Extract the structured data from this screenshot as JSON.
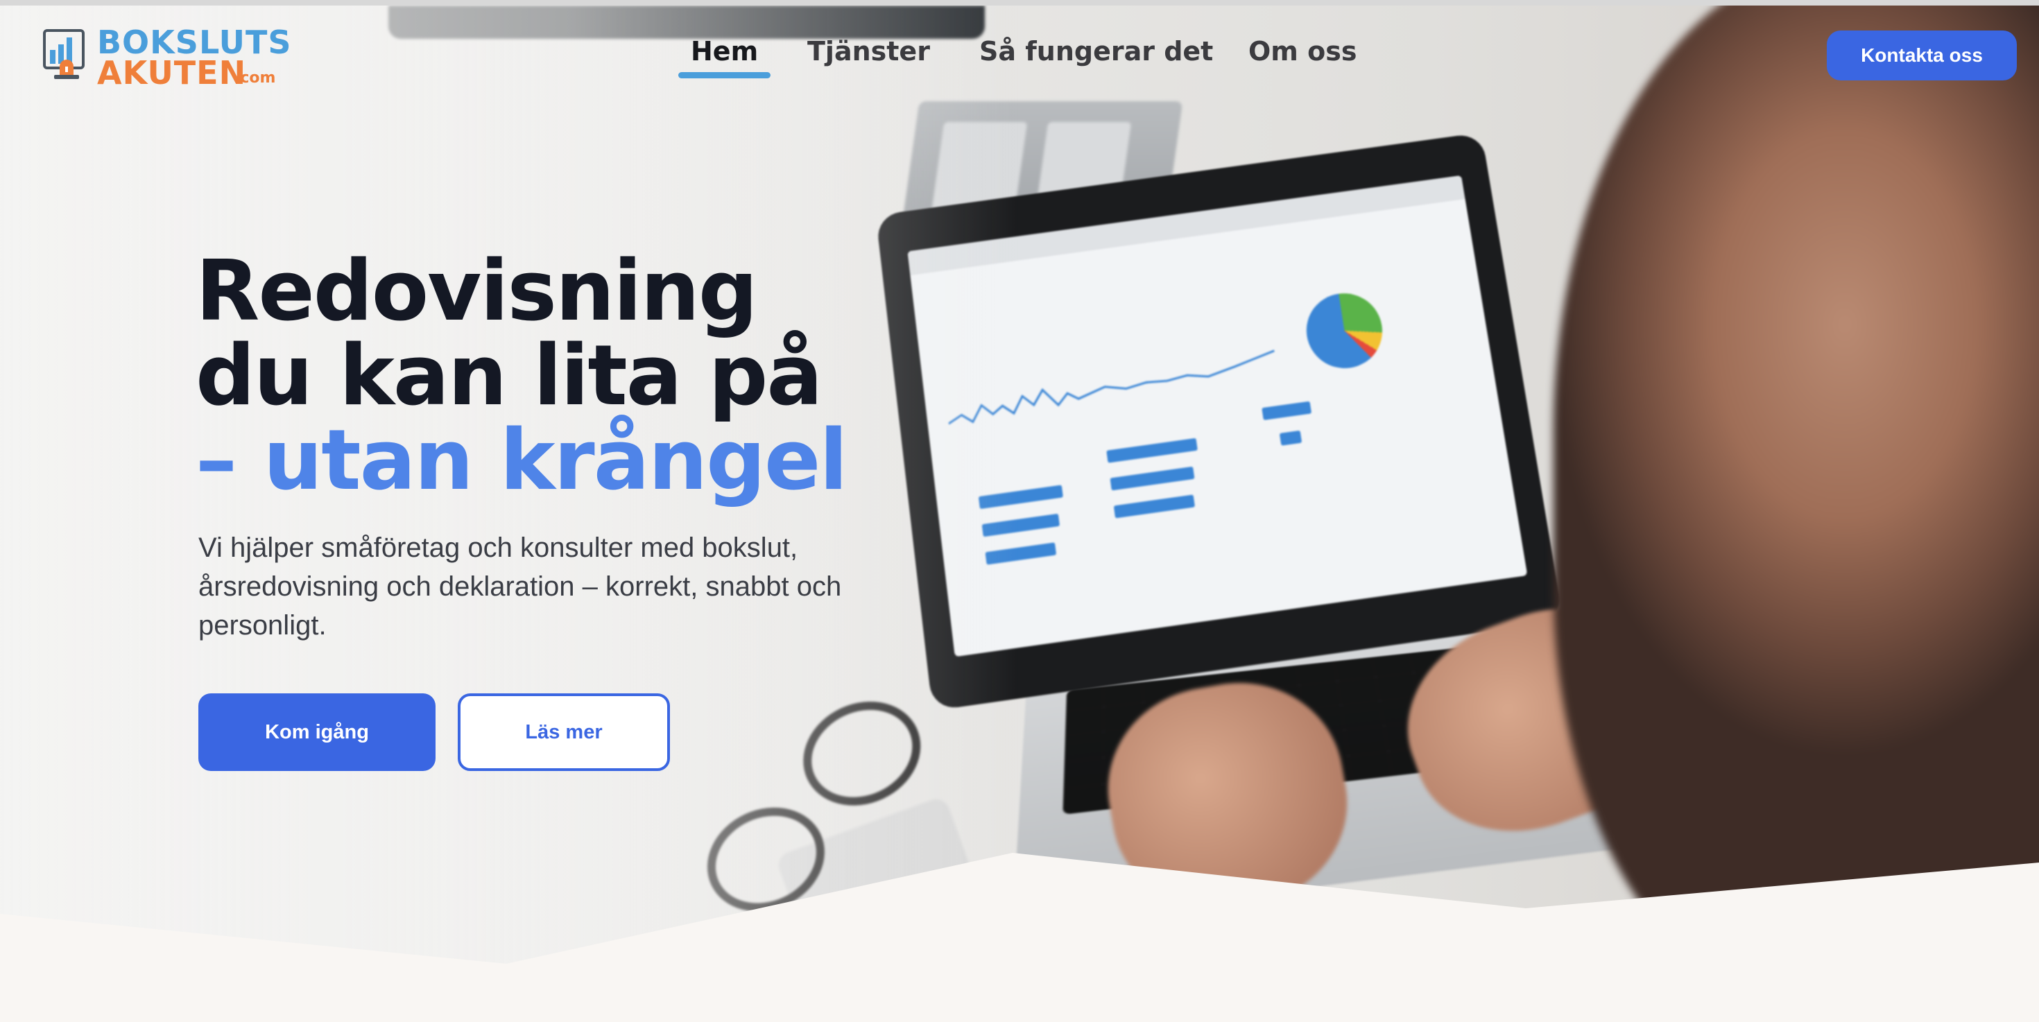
{
  "brand": {
    "line1": "BOKSLUTS",
    "line2": "AKUTEN",
    "suffix": ".com"
  },
  "nav": {
    "items": [
      {
        "label": "Hem",
        "active": true
      },
      {
        "label": "Tjänster",
        "active": false
      },
      {
        "label": "Så fungerar det",
        "active": false
      },
      {
        "label": "Om oss",
        "active": false
      }
    ]
  },
  "header": {
    "cta_label": "Kontakta oss"
  },
  "hero": {
    "headline_line1": "Redovisning",
    "headline_line2": "du kan lita på",
    "headline_line3": "– utan krångel",
    "subtext": "Vi hjälper småföretag och konsulter med bokslut, årsredovisning och deklaration – korrekt, snabbt och personligt.",
    "primary_button": "Kom igång",
    "secondary_button": "Läs mer"
  },
  "colors": {
    "accent_blue": "#3a66e2",
    "headline_accent": "#4f84e8",
    "logo_blue": "#4a9edb",
    "logo_orange": "#ef7f3a",
    "section_bg": "#f9f6f3"
  },
  "icons": {
    "logo": "bar-chart-siren-icon",
    "hero_image": "laptop-analytics-photo"
  }
}
